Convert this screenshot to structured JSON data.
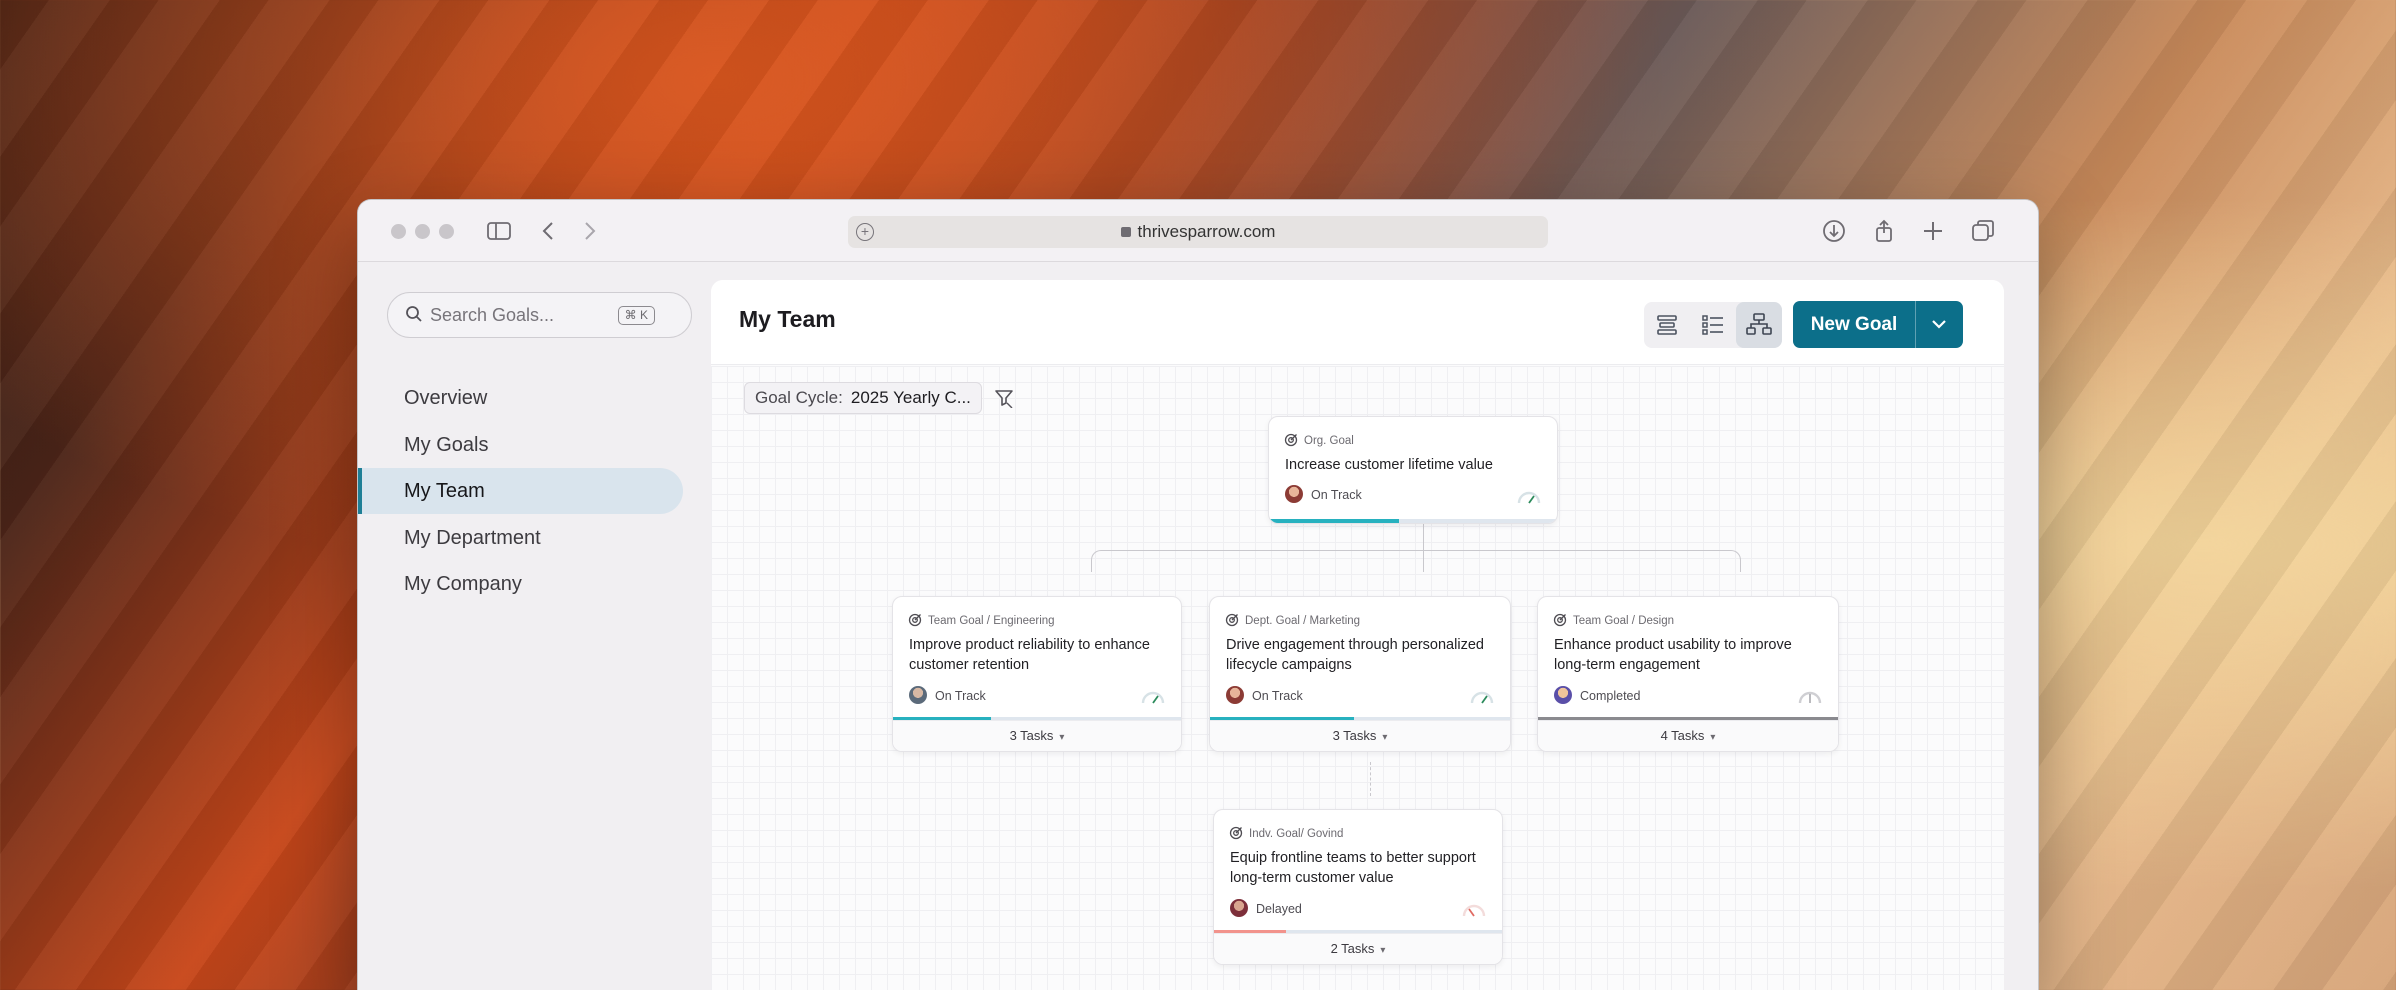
{
  "browser": {
    "url": "thrivesparrow.com"
  },
  "sidebar": {
    "search_placeholder": "Search Goals...",
    "search_shortcut": "⌘ K",
    "items": [
      {
        "label": "Overview"
      },
      {
        "label": "My Goals"
      },
      {
        "label": "My Team",
        "active": true
      },
      {
        "label": "My Department"
      },
      {
        "label": "My Company"
      }
    ]
  },
  "header": {
    "title": "My Team",
    "new_goal_label": "New Goal"
  },
  "filters": {
    "cycle_label": "Goal Cycle:",
    "cycle_value": "2025 Yearly C..."
  },
  "colors": {
    "brand": "#0c6f8a",
    "on_track": "#27b1bf",
    "completed": "#8a8a8f",
    "delayed": "#f2938c"
  },
  "goals": {
    "org": {
      "type": "Org. Goal",
      "title": "Increase customer lifetime value",
      "status": "On Track",
      "progress": 0.45
    },
    "engineering": {
      "type": "Team Goal / Engineering",
      "title": "Improve product reliability to enhance customer retention",
      "status": "On Track",
      "progress": 0.34,
      "tasks": "3 Tasks"
    },
    "marketing": {
      "type": "Dept. Goal / Marketing",
      "title": "Drive engagement through personalized lifecycle campaigns",
      "status": "On Track",
      "progress": 0.48,
      "tasks": "3 Tasks"
    },
    "design": {
      "type": "Team Goal / Design",
      "title": "Enhance product usability to improve long-term engagement",
      "status": "Completed",
      "progress": 1.0,
      "tasks": "4 Tasks"
    },
    "individual": {
      "type": "Indv. Goal/ Govind",
      "title": "Equip frontline teams to better support long-term customer value",
      "status": "Delayed",
      "progress": 0.25,
      "tasks": "2 Tasks"
    }
  }
}
